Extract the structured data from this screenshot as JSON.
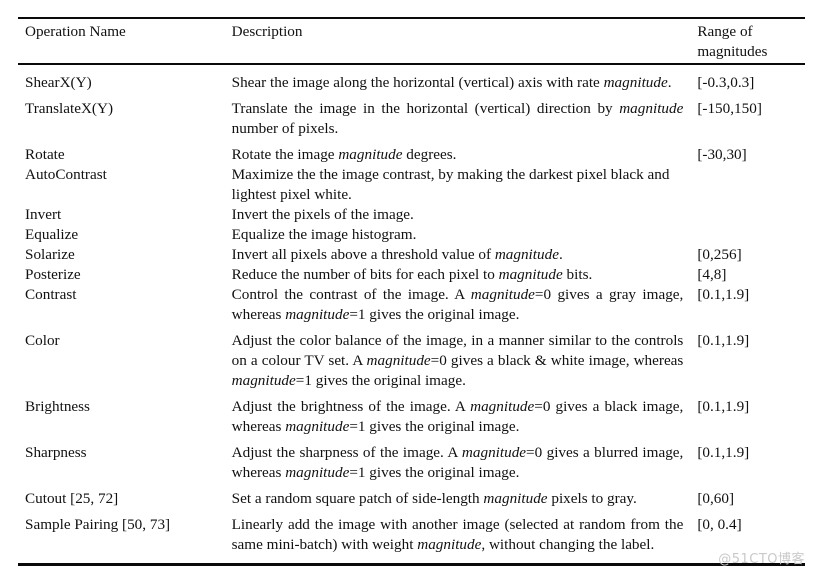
{
  "table": {
    "headers": {
      "operation_name": "Operation Name",
      "description": "Description",
      "range_line1": "Range of",
      "range_line2": "magnitudes"
    },
    "rows": [
      {
        "operation": "ShearX(Y)",
        "description": "Shear the image along the horizontal (vertical) axis with rate magnitude.",
        "range": "[-0.3,0.3]"
      },
      {
        "operation": "TranslateX(Y)",
        "description": "Translate the image in the horizontal (vertical) direction by magnitude number of pixels.",
        "range": "[-150,150]"
      },
      {
        "operation": "Rotate",
        "description": "Rotate the image magnitude degrees.",
        "range": "[-30,30]"
      },
      {
        "operation": "AutoContrast",
        "description": "Maximize the the image contrast, by making the darkest pixel black and lightest pixel white.",
        "range": ""
      },
      {
        "operation": "Invert",
        "description": "Invert the pixels of the image.",
        "range": ""
      },
      {
        "operation": "Equalize",
        "description": "Equalize the image histogram.",
        "range": ""
      },
      {
        "operation": "Solarize",
        "description": "Invert all pixels above a threshold value of magnitude.",
        "range": "[0,256]"
      },
      {
        "operation": "Posterize",
        "description": "Reduce the number of bits for each pixel to magnitude bits.",
        "range": "[4,8]"
      },
      {
        "operation": "Contrast",
        "description": "Control the contrast of the image. A magnitude=0 gives a gray image, whereas magnitude=1 gives the original image.",
        "range": "[0.1,1.9]"
      },
      {
        "operation": "Color",
        "description": "Adjust the color balance of the image, in a manner similar to the controls on a colour TV set. A magnitude=0 gives a black & white image, whereas magnitude=1 gives the original image.",
        "range": "[0.1,1.9]"
      },
      {
        "operation": "Brightness",
        "description": "Adjust the brightness of the image. A magnitude=0 gives a black image, whereas magnitude=1 gives the original image.",
        "range": "[0.1,1.9]"
      },
      {
        "operation": "Sharpness",
        "description": "Adjust the sharpness of the image.  A magnitude=0 gives a blurred image, whereas magnitude=1 gives the original image.",
        "range": "[0.1,1.9]"
      },
      {
        "operation": "Cutout [25, 72]",
        "description": "Set a random square patch of side-length magnitude pixels to gray.",
        "range": "[0,60]"
      },
      {
        "operation": "Sample Pairing [50, 73]",
        "description": "Linearly add the image with another image (selected at random from the same mini-batch) with weight magnitude, without changing the label.",
        "range": "[0, 0.4]"
      }
    ]
  },
  "watermark": {
    "text": "@51CTO博客"
  },
  "colors": {
    "rule": "#0a0a0a",
    "text": "#111111",
    "watermark": "#c9c9c9",
    "background": "#ffffff"
  }
}
